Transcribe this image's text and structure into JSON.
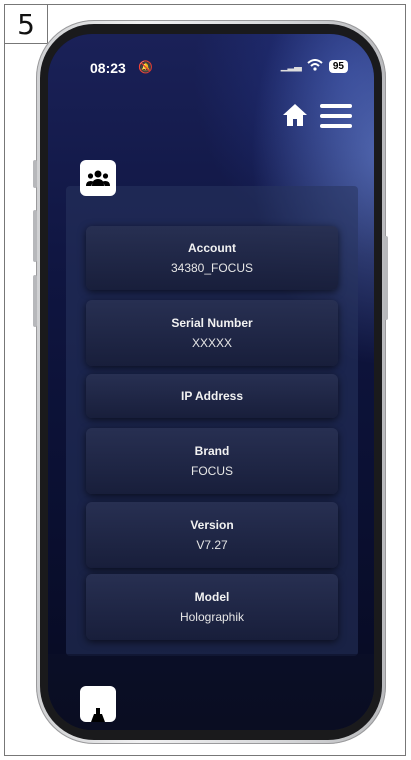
{
  "step_number": "5",
  "status_bar": {
    "time": "08:23",
    "bell": "🔕",
    "signal": "▁▂▃",
    "wifi": "◠",
    "battery": "95"
  },
  "header": {
    "home_icon": "home-icon",
    "menu_icon": "hamburger-menu-icon"
  },
  "section_icon": "users-group-icon",
  "info_items": [
    {
      "label": "Account",
      "value": "34380_FOCUS"
    },
    {
      "label": "Serial Number",
      "value": "XXXXX"
    },
    {
      "label": "IP Address",
      "value": ""
    },
    {
      "label": "Brand",
      "value": "FOCUS"
    },
    {
      "label": "Version",
      "value": "V7.27"
    },
    {
      "label": "Model",
      "value": "Holographik"
    }
  ],
  "colors": {
    "background": "#0b1030",
    "card": "#26304f",
    "text": "#ffffff"
  }
}
